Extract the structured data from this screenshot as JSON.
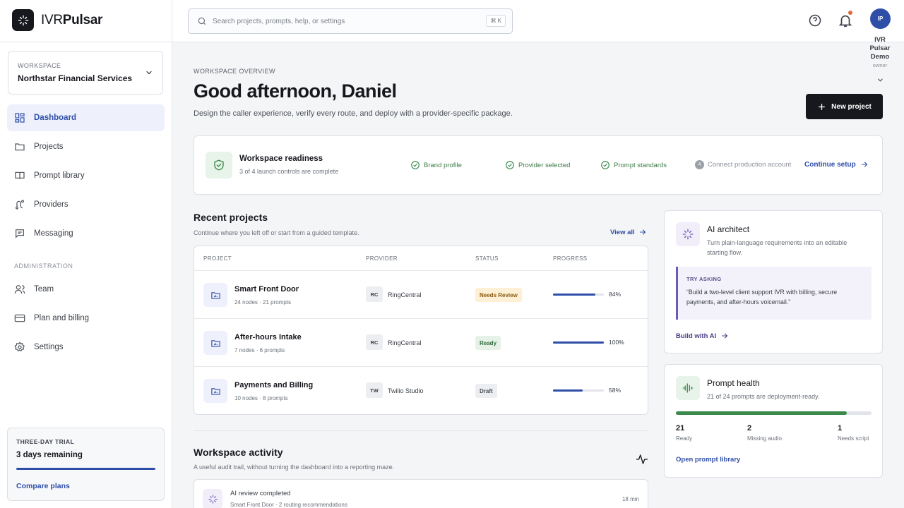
{
  "brand": {
    "prefix": "IVR",
    "suffix": "Pulsar"
  },
  "workspace": {
    "eyebrow": "WORKSPACE",
    "name": "Northstar Financial Services"
  },
  "nav": {
    "items": [
      {
        "label": "Dashboard",
        "icon": "dashboard-icon",
        "active": true
      },
      {
        "label": "Projects",
        "icon": "folder-icon"
      },
      {
        "label": "Prompt library",
        "icon": "book-icon"
      },
      {
        "label": "Providers",
        "icon": "route-icon"
      },
      {
        "label": "Messaging",
        "icon": "message-icon"
      }
    ],
    "admin_label": "ADMINISTRATION",
    "admin_items": [
      {
        "label": "Team",
        "icon": "users-icon"
      },
      {
        "label": "Plan and billing",
        "icon": "credit-card-icon"
      },
      {
        "label": "Settings",
        "icon": "gear-icon"
      }
    ]
  },
  "trial": {
    "eyebrow": "THREE-DAY TRIAL",
    "title": "3 days remaining",
    "progress": 1.0,
    "link": "Compare plans"
  },
  "search": {
    "placeholder": "Search projects, prompts, help, or settings",
    "shortcut": "⌘ K"
  },
  "user": {
    "initials": "IP",
    "name": "IVR Pulsar Demo",
    "role": "owner"
  },
  "overview": {
    "eyebrow": "WORKSPACE OVERVIEW",
    "greeting": "Good afternoon, Daniel",
    "subtitle": "Design the caller experience, verify every route, and deploy with a provider-specific package.",
    "new_project": "New project"
  },
  "readiness": {
    "title": "Workspace readiness",
    "subtitle": "3 of 4 launch controls are complete",
    "steps": [
      {
        "label": "Brand profile",
        "done": true
      },
      {
        "label": "Provider selected",
        "done": true
      },
      {
        "label": "Prompt standards",
        "done": true
      },
      {
        "label": "Connect production account",
        "done": false,
        "number": "4"
      }
    ],
    "cta": "Continue setup"
  },
  "recent": {
    "title": "Recent projects",
    "subtitle": "Continue where you left off or start from a guided template.",
    "view_all": "View all",
    "columns": [
      "PROJECT",
      "PROVIDER",
      "STATUS",
      "PROGRESS"
    ],
    "rows": [
      {
        "name": "Smart Front Door",
        "meta": "24 nodes · 21 prompts",
        "provider_code": "RC",
        "provider": "RingCentral",
        "status": "Needs Review",
        "progress": 84,
        "pct": "84%"
      },
      {
        "name": "After-hours Intake",
        "meta": "7 nodes · 6 prompts",
        "provider_code": "RC",
        "provider": "RingCentral",
        "status": "Ready",
        "progress": 100,
        "pct": "100%"
      },
      {
        "name": "Payments and Billing",
        "meta": "10 nodes · 8 prompts",
        "provider_code": "TW",
        "provider": "Twilio Studio",
        "status": "Draft",
        "progress": 58,
        "pct": "58%"
      }
    ]
  },
  "activity": {
    "title": "Workspace activity",
    "subtitle": "A useful audit trail, without turning the dashboard into a reporting maze.",
    "items": [
      {
        "title": "AI review completed",
        "meta": "Smart Front Door · 2 routing recommendations",
        "time": "18 min"
      }
    ]
  },
  "ai": {
    "title": "AI architect",
    "subtitle": "Turn plain-language requirements into an editable starting flow.",
    "try_label": "TRY ASKING",
    "try_text": "“Build a two-level client support IVR with billing, secure payments, and after-hours voicemail.”",
    "cta": "Build with AI"
  },
  "health": {
    "title": "Prompt health",
    "subtitle": "21 of 24 prompts are deployment-ready.",
    "ready_fraction": 0.875,
    "stats": [
      {
        "value": "21",
        "label": "Ready"
      },
      {
        "value": "2",
        "label": "Missing audio"
      },
      {
        "value": "1",
        "label": "Needs script"
      }
    ],
    "cta": "Open prompt library"
  },
  "colors": {
    "accent": "#2f4ea8",
    "ready": "#3b8a4b",
    "review_bg": "#fdf0d5",
    "review_fg": "#8a5a12",
    "ready_bg": "#e6f2e8",
    "ready_fg": "#2e6b3b",
    "draft_bg": "#eceef1",
    "draft_fg": "#4b5058"
  }
}
